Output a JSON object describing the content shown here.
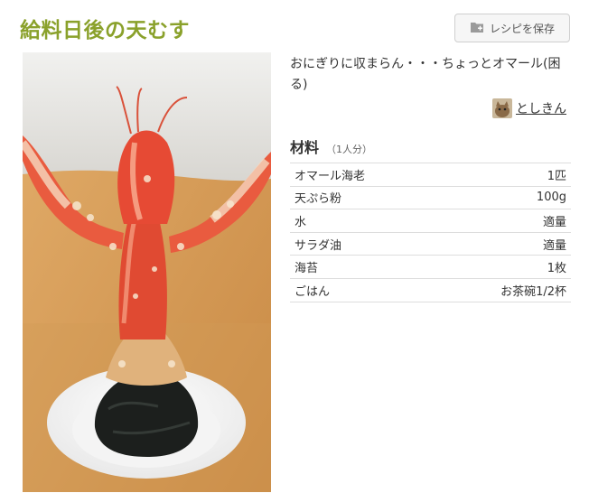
{
  "recipe": {
    "title": "給料日後の天むす",
    "save_button": {
      "label": "レシピを保存",
      "icon": "folder-plus-icon"
    },
    "photo": {
      "subject": "lobster-tempura-onigiri"
    },
    "description": "おにぎりに収まらん・・・ちょっとオマール(困る)",
    "author": {
      "name": "としきん",
      "avatar": "cat-avatar"
    }
  },
  "ingredients": {
    "title": "材料",
    "serving": "（1人分）",
    "rows": [
      {
        "name": "オマール海老",
        "quantity": "1匹"
      },
      {
        "name": "天ぷら粉",
        "quantity": "100g"
      },
      {
        "name": "水",
        "quantity": "適量"
      },
      {
        "name": "サラダ油",
        "quantity": "適量"
      },
      {
        "name": "海苔",
        "quantity": "1枚"
      },
      {
        "name": "ごはん",
        "quantity": "お茶碗1/2杯"
      }
    ]
  },
  "colors": {
    "title": "#8aa12b",
    "text": "#333333",
    "border": "#dddddd"
  }
}
